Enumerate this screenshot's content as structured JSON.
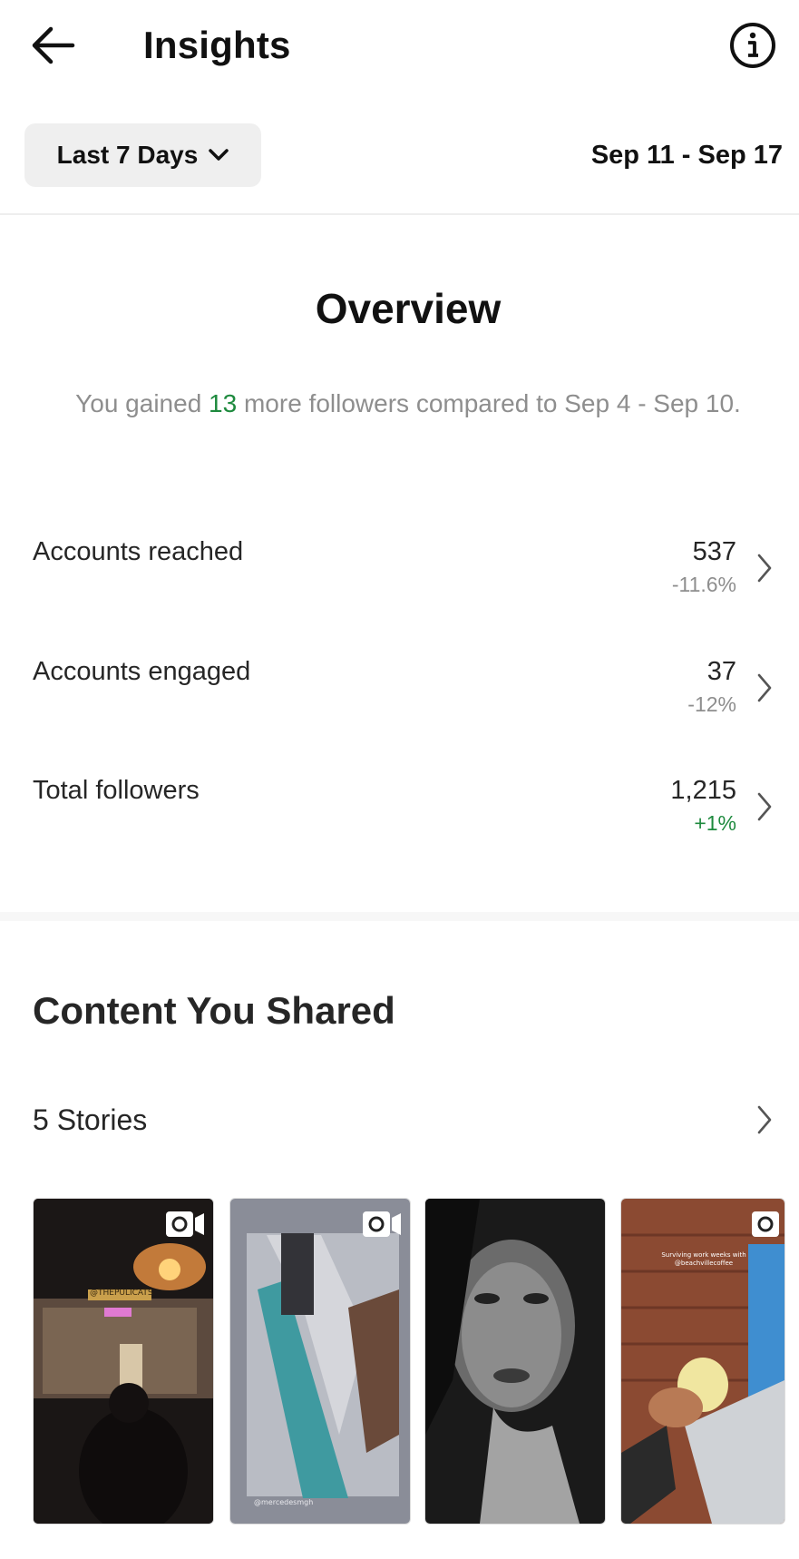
{
  "header": {
    "title": "Insights",
    "back_icon": "arrow-left-icon",
    "info_icon": "info-icon"
  },
  "filter": {
    "range_label": "Last 7 Days",
    "date_range": "Sep 11 - Sep 17"
  },
  "overview": {
    "heading": "Overview",
    "gain_prefix": "You gained ",
    "gain_count": "13",
    "gain_suffix": " more followers compared to Sep 4 - Sep 10.",
    "metrics": [
      {
        "label": "Accounts reached",
        "value": "537",
        "change": "-11.6%"
      },
      {
        "label": "Accounts engaged",
        "value": "37",
        "change": "-12%"
      },
      {
        "label": "Total followers",
        "value": "1,215",
        "change": "+1%"
      }
    ]
  },
  "content": {
    "heading": "Content You Shared",
    "stories_label": "5 Stories",
    "thumbnails": [
      {
        "overlay_text": "@THEPULICATS"
      },
      {
        "overlay_text": "@mercedesmgh"
      },
      {
        "overlay_text": ""
      },
      {
        "overlay_text": "Surviving work weeks with @beachvillecoffee"
      }
    ]
  },
  "colors": {
    "positive": "#1e8a3e",
    "muted": "#8e8e8e",
    "button_bg": "#efefef"
  }
}
